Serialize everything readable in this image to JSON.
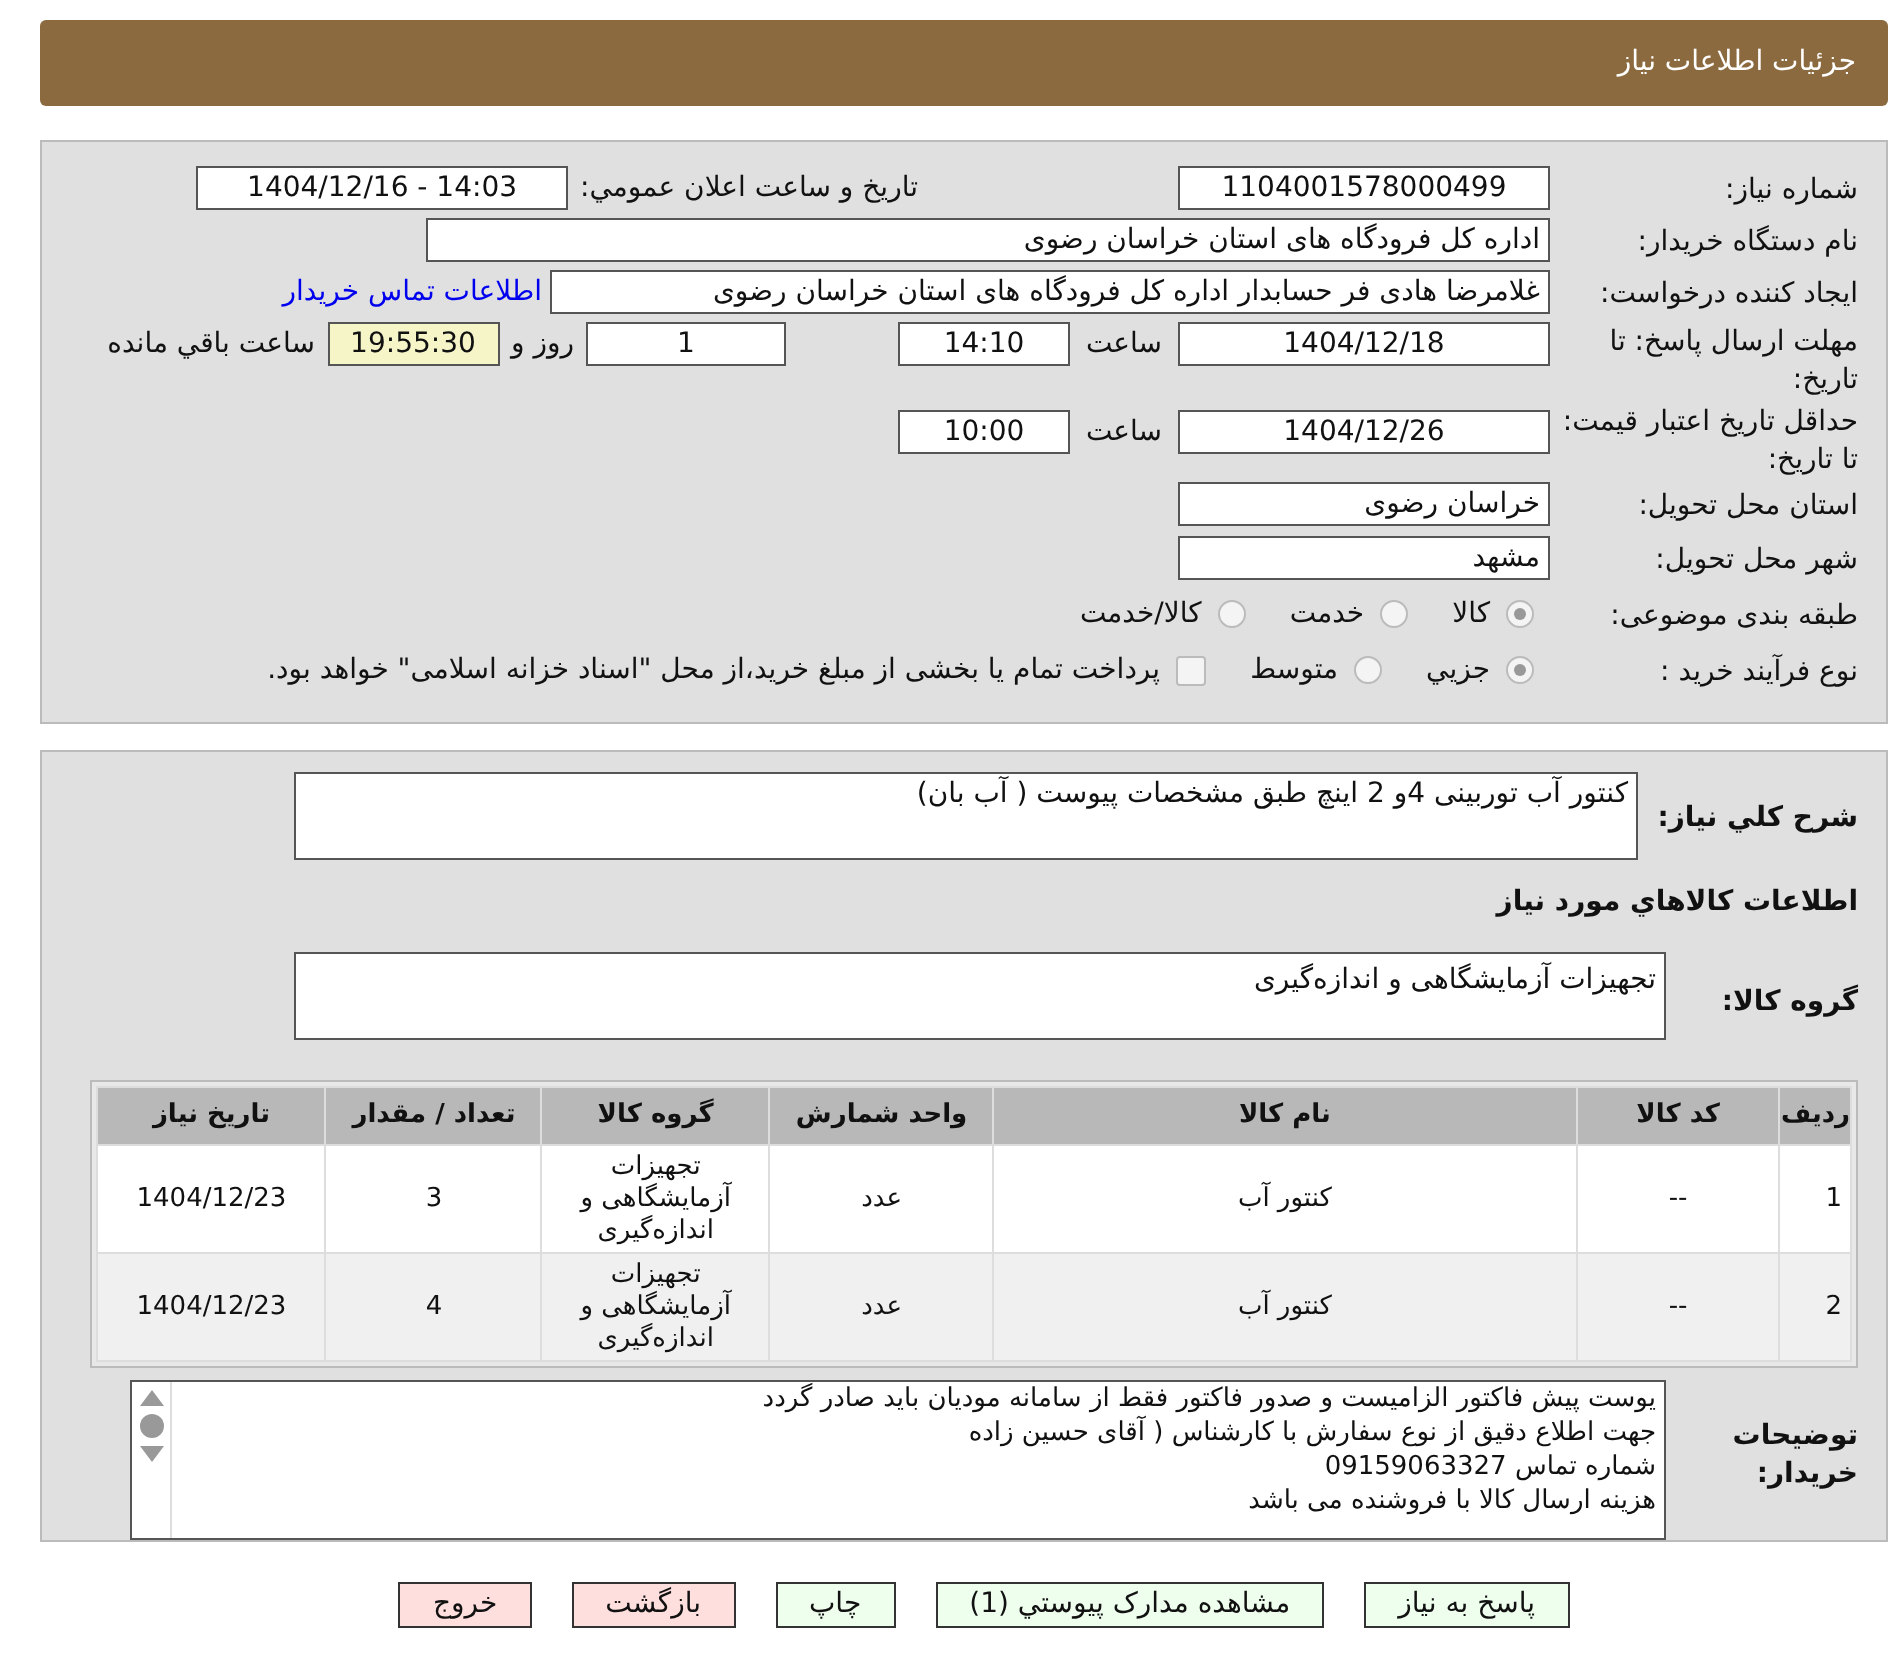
{
  "header": {
    "title": "جزئیات اطلاعات نیاز"
  },
  "info": {
    "need_number": {
      "label": "شماره نیاز:",
      "value": "1104001578000499"
    },
    "announce": {
      "label": "تاریخ و ساعت اعلان عمومي:",
      "value": "1404/12/16 - 14:03"
    },
    "buyer": {
      "label": "نام دستگاه خریدار:",
      "value": "اداره کل فرودگاه های استان خراسان رضوی"
    },
    "creator": {
      "label": "ایجاد کننده درخواست:",
      "value": "غلامرضا هادی فر حسابدار اداره کل فرودگاه های استان خراسان رضوی"
    },
    "contact_link": "اطلاعات تماس خریدار",
    "deadline": {
      "label": "مهلت ارسال پاسخ: تا تاریخ:",
      "date": "1404/12/18",
      "time_label": "ساعت",
      "time": "14:10",
      "days": "1",
      "days_label": "روز و",
      "remaining": "19:55:30",
      "remaining_label": "ساعت باقي مانده"
    },
    "validity": {
      "label": "حداقل تاریخ اعتبار قیمت: تا تاریخ:",
      "date": "1404/12/26",
      "time_label": "ساعت",
      "time": "10:00"
    },
    "province": {
      "label": "استان محل تحویل:",
      "value": "خراسان رضوی"
    },
    "city": {
      "label": "شهر محل تحویل:",
      "value": "مشهد"
    },
    "category": {
      "label": "طبقه بندی موضوعی:",
      "options": [
        {
          "label": "کالا",
          "selected": true
        },
        {
          "label": "خدمت",
          "selected": false
        },
        {
          "label": "کالا/خدمت",
          "selected": false
        }
      ]
    },
    "process": {
      "label": "نوع فرآیند خرید :",
      "options": [
        {
          "label": "جزيي",
          "selected": true
        },
        {
          "label": "متوسط",
          "selected": false
        }
      ],
      "payment": {
        "checked": false,
        "label": "پرداخت تمام یا بخشی از مبلغ خرید،از محل \"اسناد خزانه اسلامی\" خواهد بود."
      }
    }
  },
  "details": {
    "summary": {
      "label": "شرح كلي نياز:",
      "value": "کنتور آب توربینی 4و 2 اینچ طبق مشخصات پیوست ( آب بان)"
    },
    "goods_heading": "اطلاعات كالاهاي مورد نياز",
    "group": {
      "label": "گروه کالا:",
      "value": "تجهیزات آزمایشگاهی و اندازه‌گیری"
    },
    "table": {
      "columns": [
        "ردیف",
        "کد کالا",
        "نام کالا",
        "واحد شمارش",
        "گروه کالا",
        "تعداد / مقدار",
        "تاریخ نیاز"
      ],
      "rows": [
        [
          "1",
          "--",
          "کنتور آب",
          "عدد",
          "تجهیزات آزمایشگاهی و اندازه‌گیری",
          "3",
          "1404/12/23"
        ],
        [
          "2",
          "--",
          "کنتور آب",
          "عدد",
          "تجهیزات آزمایشگاهی و اندازه‌گیری",
          "4",
          "1404/12/23"
        ]
      ]
    },
    "notes": {
      "label": "توضیحات خریدار:",
      "lines": [
        "یوست پیش فاکتور الزامیست و صدور فاکتور فقط از سامانه مودیان باید صادر گردد",
        "جهت اطلاع دقیق از نوع سفارش با کارشناس  ( آقای  حسین زاده",
        "شماره تماس  09159063327",
        "هزینه ارسال کالا با فروشنده می باشد"
      ]
    }
  },
  "buttons": [
    {
      "label": "پاسخ به نیاز",
      "kind": "action"
    },
    {
      "label": "مشاهده مدارک پیوستي (1)",
      "kind": "action"
    },
    {
      "label": "چاپ",
      "kind": "action"
    },
    {
      "label": "بازگشت",
      "kind": "exit"
    },
    {
      "label": "خروج",
      "kind": "exit"
    }
  ]
}
